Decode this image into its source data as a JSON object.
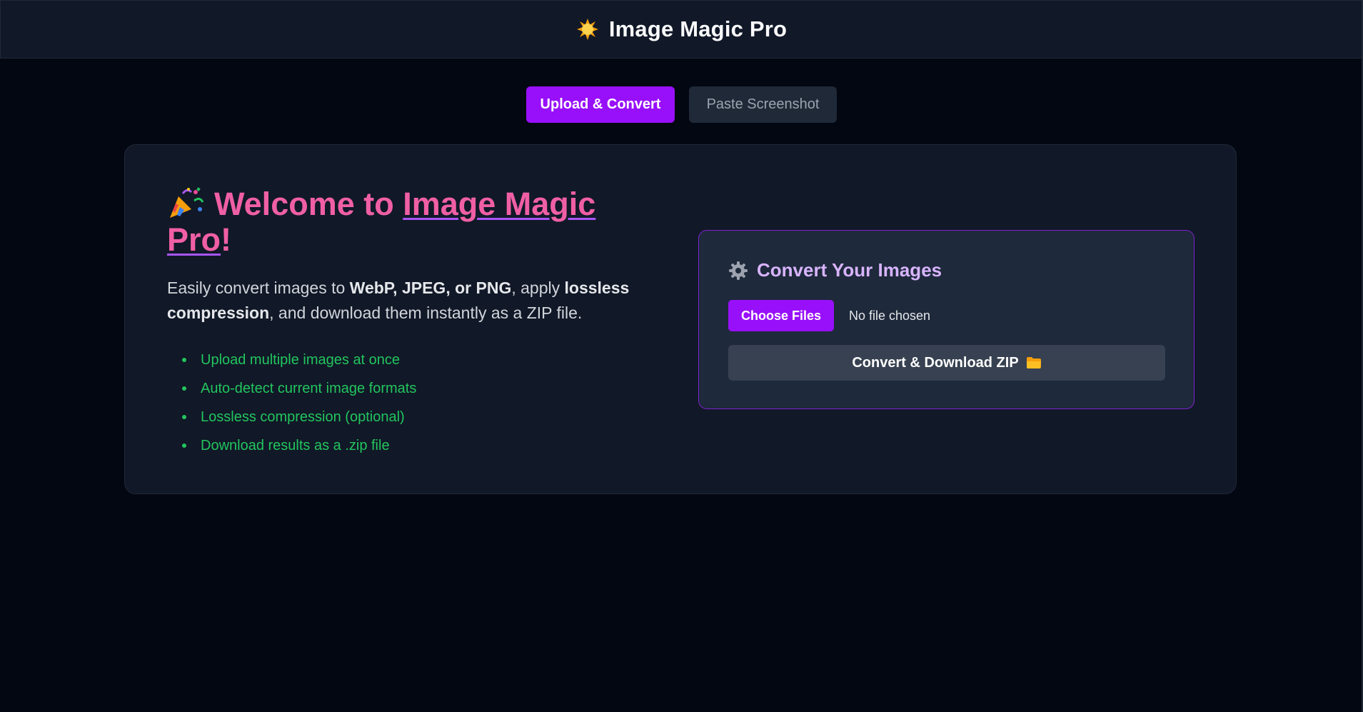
{
  "header": {
    "title": "Image Magic Pro",
    "icon": "sun-icon"
  },
  "tabs": [
    {
      "label": "Upload & Convert",
      "active": true
    },
    {
      "label": "Paste Screenshot",
      "active": false
    }
  ],
  "welcome": {
    "icon": "party-popper-icon",
    "title_prefix": "Welcome to",
    "title_brand": "Image Magic Pro",
    "title_suffix": "!",
    "intro_1": "Easily convert images to",
    "intro_bold_1": "WebP, JPEG, or PNG",
    "intro_2": ", apply",
    "intro_bold_2": "lossless compression",
    "intro_3": ", and download them instantly as a ZIP file.",
    "features": [
      "Upload multiple images at once",
      "Auto-detect current image formats",
      "Lossless compression (optional)",
      "Download results as a .zip file"
    ]
  },
  "converter": {
    "icon": "gear-icon",
    "title": "Convert Your Images",
    "choose_files_label": "Choose Files",
    "file_status": "No file chosen",
    "convert_button_label": "Convert & Download ZIP",
    "convert_button_icon": "folder-icon"
  },
  "colors": {
    "background": "#030712",
    "header": "#111827",
    "accent": "#9810fa",
    "welcome_title": "#f05fa5",
    "feature_text": "#22c55e",
    "panel_border": "#7e22ce",
    "panel_title": "#d8b4fe"
  }
}
